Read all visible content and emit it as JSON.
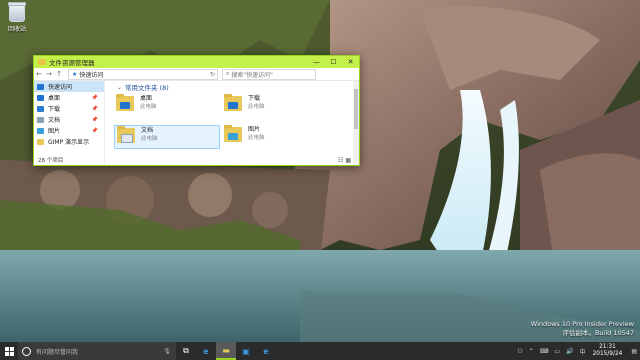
{
  "desktop": {
    "recycle_bin_label": "回收站",
    "watermark": {
      "line1": "Windows 10 Pro Insider Preview",
      "line2": "评估副本。Build 10547"
    }
  },
  "window": {
    "title": "文件资源管理器",
    "controls": {
      "minimize": "—",
      "maximize": "☐",
      "close": "✕"
    },
    "address": {
      "back": "←",
      "forward": "→",
      "up": "↑",
      "path": "快速访问",
      "refresh": "↻"
    },
    "search_placeholder": "搜索\"快速访问\"",
    "sidebar": [
      {
        "label": "快速访问",
        "icon": "star-icon",
        "selected": true
      },
      {
        "label": "桌面",
        "icon": "desktop-folder-icon",
        "pinned": true
      },
      {
        "label": "下载",
        "icon": "download-icon",
        "pinned": true
      },
      {
        "label": "文档",
        "icon": "document-icon",
        "pinned": true
      },
      {
        "label": "图片",
        "icon": "picture-icon",
        "pinned": true
      },
      {
        "label": "GIMP 演示显示",
        "icon": "folder-icon"
      }
    ],
    "section_title": "常用文件夹 (8)",
    "tiles": [
      {
        "name": "桌面",
        "sub": "此电脑",
        "icon": "desktop-folder-icon",
        "color": "#1e74d0"
      },
      {
        "name": "下载",
        "sub": "此电脑",
        "icon": "download-folder-icon",
        "color": "#1e74d0"
      },
      {
        "name": "文档",
        "sub": "此电脑",
        "icon": "document-folder-icon",
        "color": "#6b8aa8"
      },
      {
        "name": "图片",
        "sub": "此电脑",
        "icon": "picture-folder-icon",
        "color": "#3aa0d8"
      }
    ],
    "status": "28 个项目"
  },
  "taskbar": {
    "search_placeholder": "有问题尽管问我",
    "clock_time": "21:31",
    "clock_date": "2015/9/24",
    "accent": "#9ad11e"
  }
}
